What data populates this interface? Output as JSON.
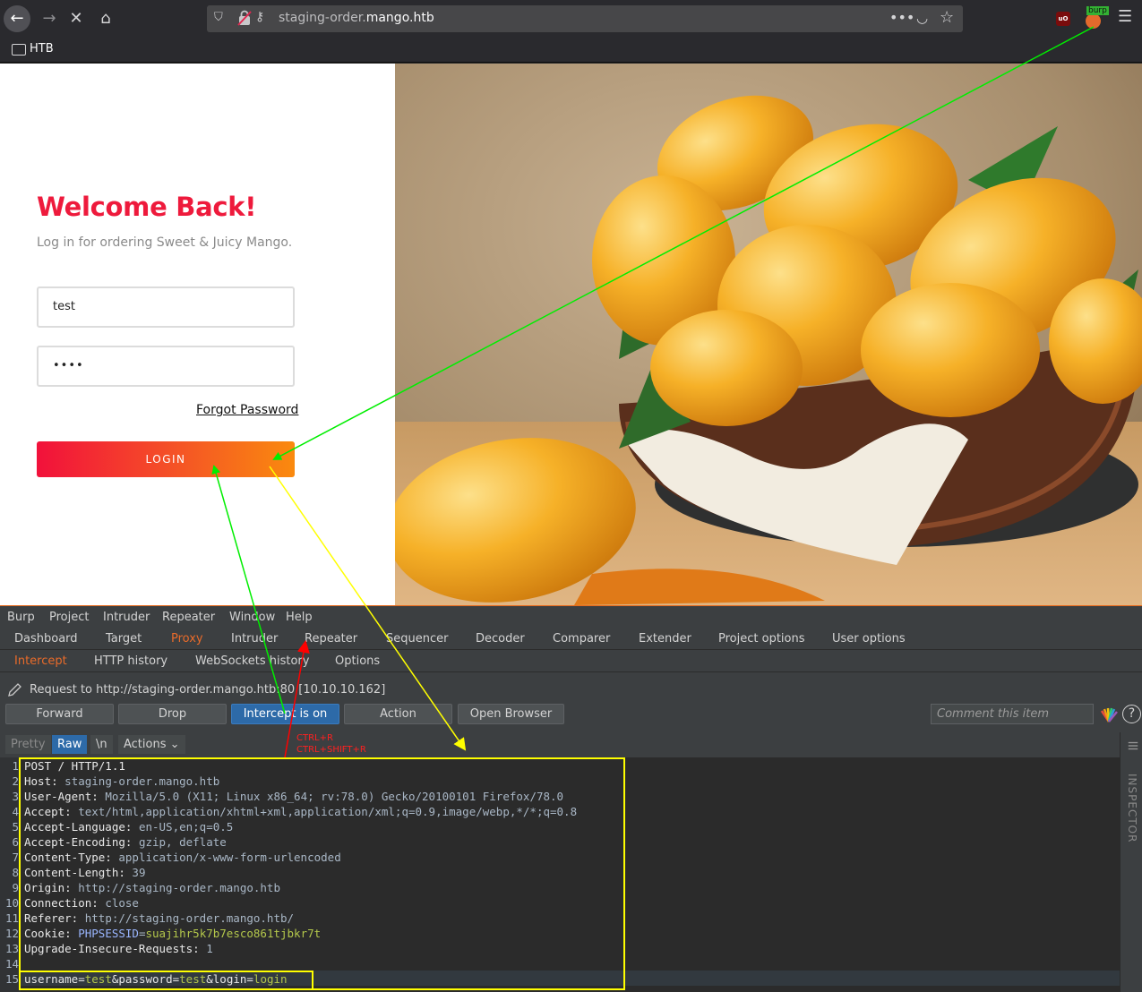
{
  "browser": {
    "url_prefix": "staging-order.",
    "url_domain": "mango.htb",
    "bookmark_folder": "HTB",
    "extension_badge": "burp"
  },
  "login_page": {
    "heading": "Welcome Back!",
    "subtitle": "Log in for ordering Sweet & Juicy Mango.",
    "username_value": "test",
    "password_value": "••••",
    "forgot_password": "Forgot Password",
    "login_button": "LOGIN"
  },
  "burp": {
    "menu": [
      "Burp",
      "Project",
      "Intruder",
      "Repeater",
      "Window",
      "Help"
    ],
    "tabs": [
      "Dashboard",
      "Target",
      "Proxy",
      "Intruder",
      "Repeater",
      "Sequencer",
      "Decoder",
      "Comparer",
      "Extender",
      "Project options",
      "User options"
    ],
    "active_tab": "Proxy",
    "subtabs": [
      "Intercept",
      "HTTP history",
      "WebSockets history",
      "Options"
    ],
    "active_subtab": "Intercept",
    "request_info": "Request to http://staging-order.mango.htb:80  [10.10.10.162]",
    "buttons": {
      "forward": "Forward",
      "drop": "Drop",
      "intercept": "Intercept is on",
      "action": "Action",
      "open_browser": "Open Browser"
    },
    "comment_placeholder": "Comment this item",
    "editor_toolbar": {
      "pretty": "Pretty",
      "raw": "Raw",
      "newline": "\\n",
      "actions": "Actions"
    },
    "inspector_label": "INSPECTOR",
    "request_lines": [
      {
        "n": "1",
        "text": "POST / HTTP/1.1"
      },
      {
        "n": "2",
        "key": "Host:",
        "val": " staging-order.mango.htb"
      },
      {
        "n": "3",
        "key": "User-Agent:",
        "val": " Mozilla/5.0 (X11; Linux x86_64; rv:78.0) Gecko/20100101 Firefox/78.0"
      },
      {
        "n": "4",
        "key": "Accept:",
        "val": " text/html,application/xhtml+xml,application/xml;q=0.9,image/webp,*/*;q=0.8"
      },
      {
        "n": "5",
        "key": "Accept-Language:",
        "val": " en-US,en;q=0.5"
      },
      {
        "n": "6",
        "key": "Accept-Encoding:",
        "val": " gzip, deflate"
      },
      {
        "n": "7",
        "key": "Content-Type:",
        "val": " application/x-www-form-urlencoded"
      },
      {
        "n": "8",
        "key": "Content-Length:",
        "val": " 39"
      },
      {
        "n": "9",
        "key": "Origin:",
        "val": " http://staging-order.mango.htb"
      },
      {
        "n": "10",
        "key": "Connection:",
        "val": " close"
      },
      {
        "n": "11",
        "key": "Referer:",
        "val": " http://staging-order.mango.htb/"
      },
      {
        "n": "12",
        "key": "Cookie:",
        "cookie_name": "PHPSESSID",
        "cookie_value": "suajihr5k7b7esco861tjbkr7t"
      },
      {
        "n": "13",
        "key": "Upgrade-Insecure-Requests:",
        "val": " 1"
      },
      {
        "n": "14",
        "text": ""
      },
      {
        "n": "15",
        "body": [
          [
            "username",
            "test"
          ],
          [
            "password",
            "test"
          ],
          [
            "login",
            "login"
          ]
        ]
      }
    ]
  },
  "annotations": {
    "shortcut_1": "CTRL+R",
    "shortcut_2": "CTRL+SHIFT+R",
    "colors": {
      "green": "#00ee00",
      "yellow": "#ffff00",
      "red": "#ff0000"
    }
  },
  "colors": {
    "accent_red": "#ee1a3c",
    "burp_orange": "#e96b2a",
    "burp_blue": "#2d6aa8"
  }
}
